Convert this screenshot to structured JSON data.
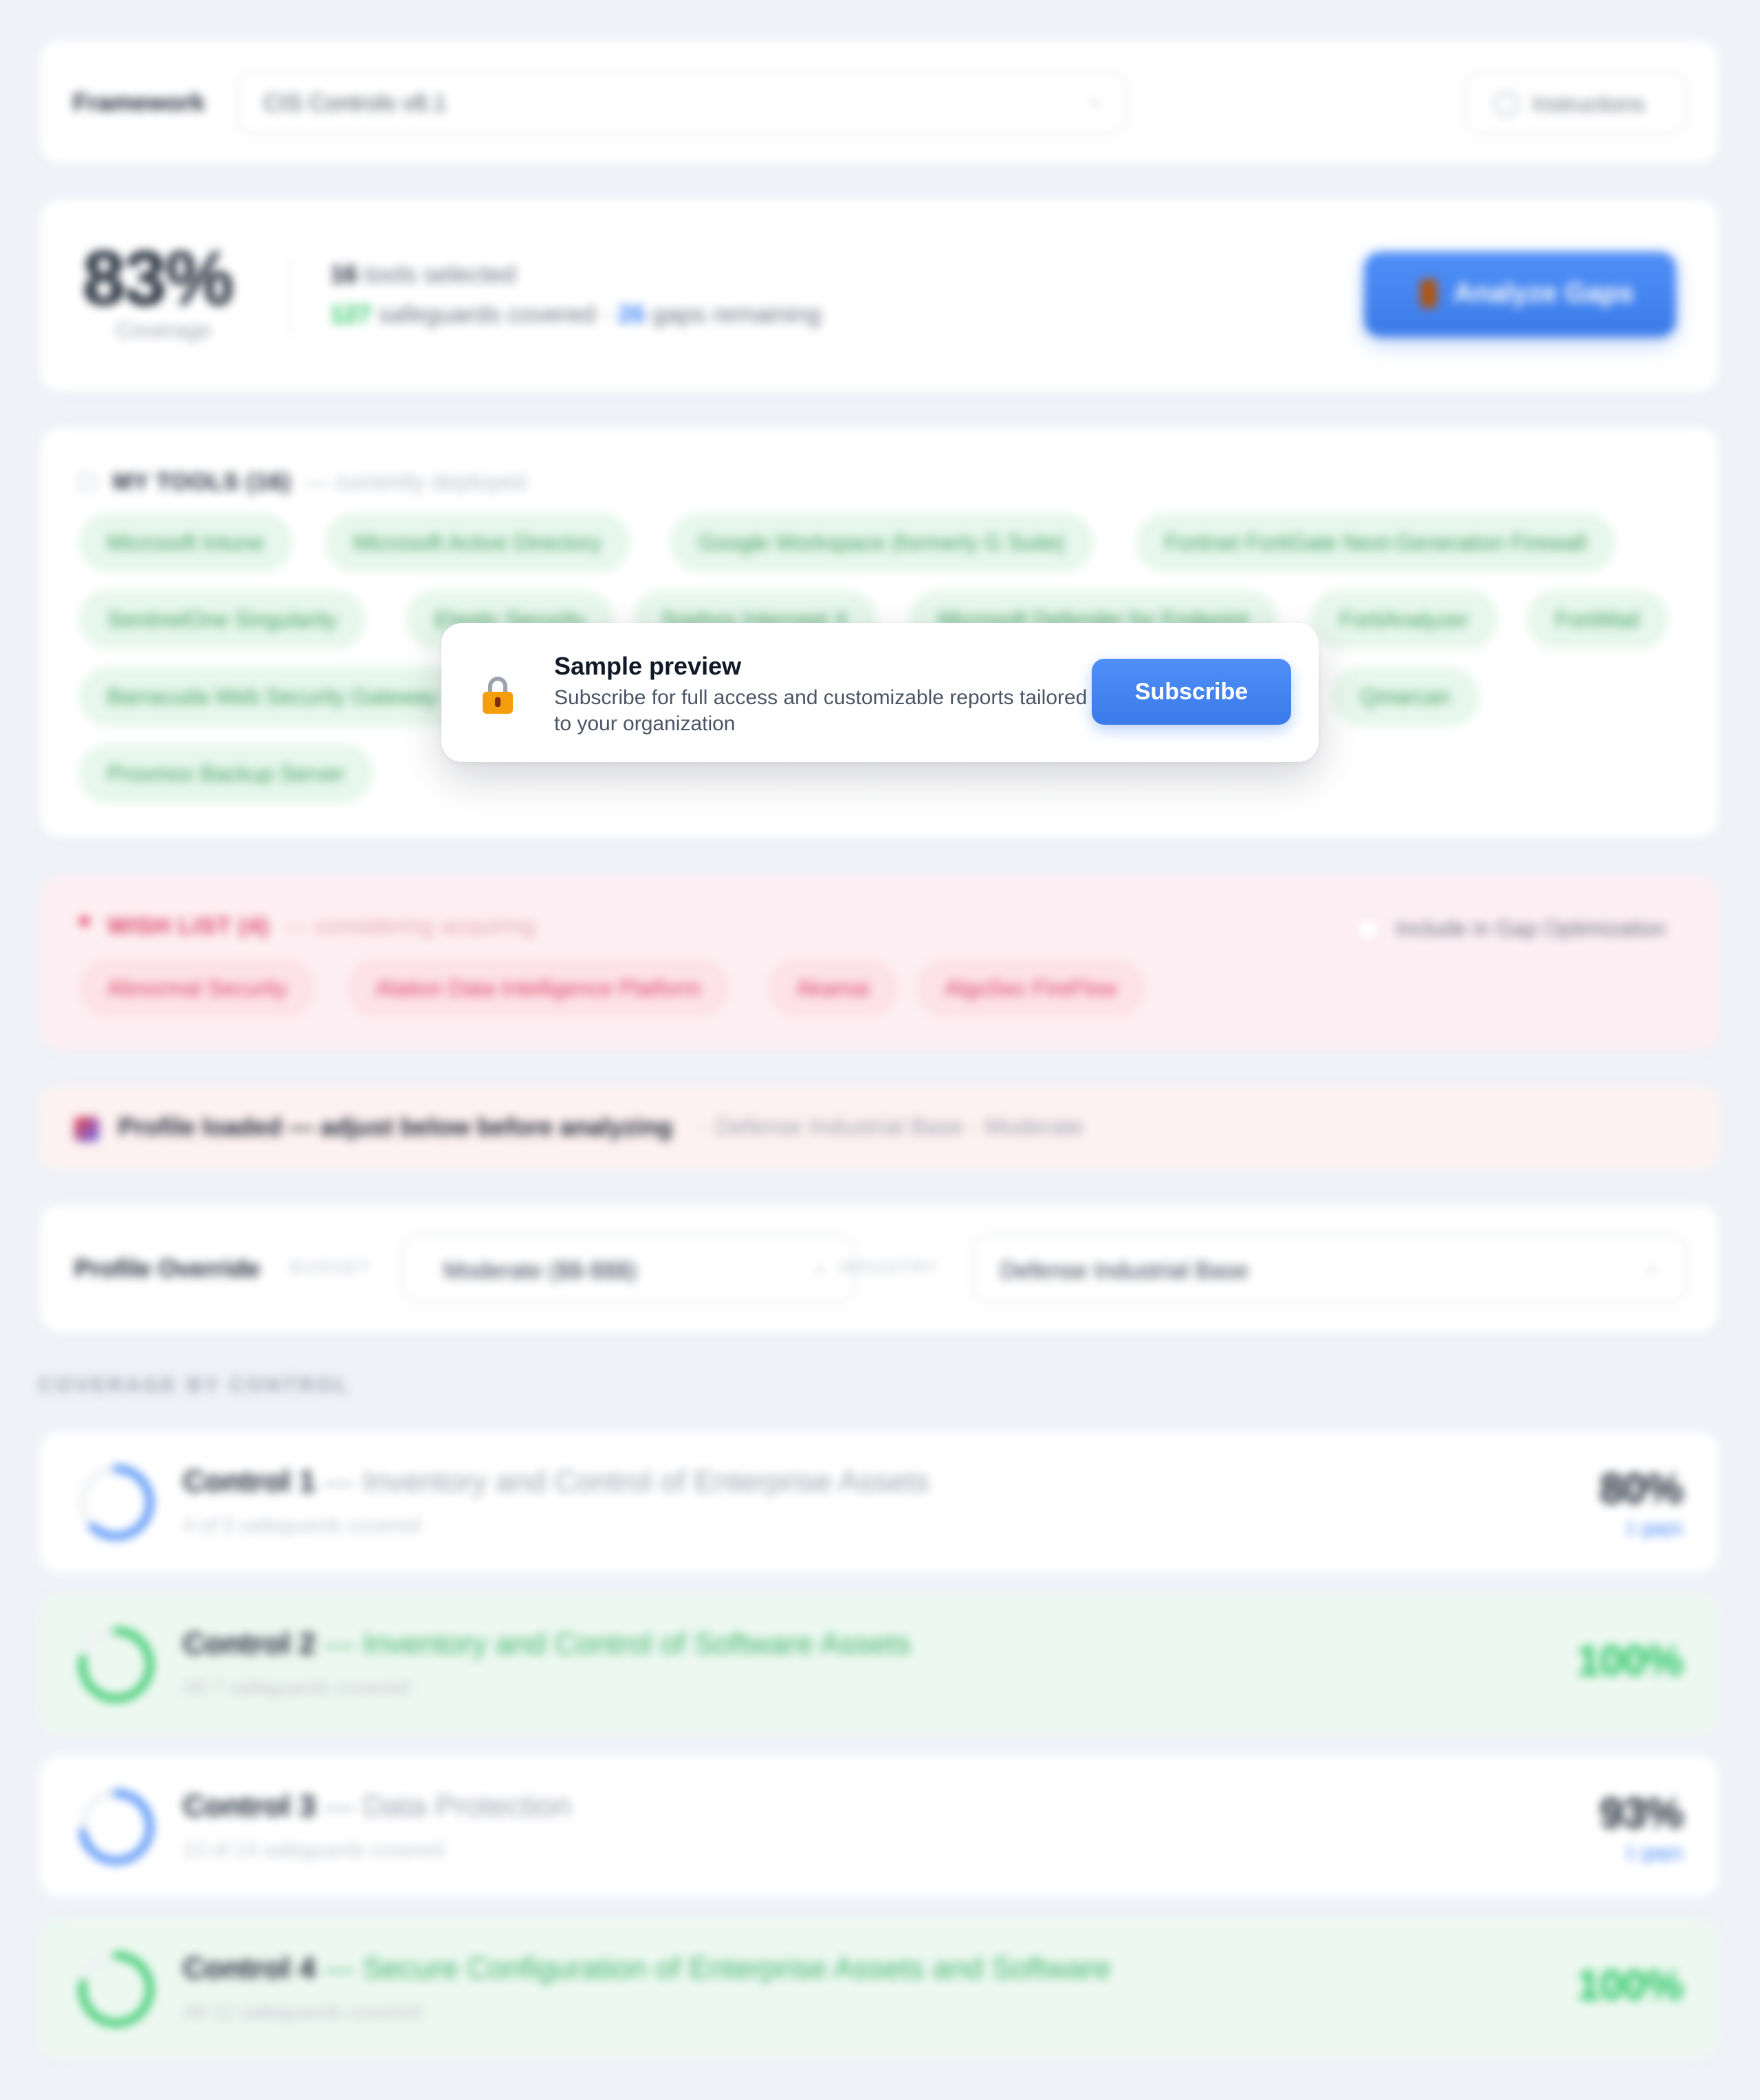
{
  "framework": {
    "label": "Framework",
    "value": "CIS Controls v8.1",
    "instructions_label": "Instructions"
  },
  "summary": {
    "coverage_pct": "83%",
    "coverage_label": "Coverage",
    "tools_selected_count": "16",
    "tools_selected_text": "tools selected",
    "safeguards_covered_count": "127",
    "safeguards_covered_text": "safeguards covered",
    "separator": "·",
    "gaps_count": "26",
    "gaps_text": "gaps remaining",
    "analyze_label": "Analyze Gaps"
  },
  "my_tools": {
    "title": "MY TOOLS (16)",
    "subtitle": "— currently deployed",
    "chips": [
      "Microsoft Intune",
      "Microsoft Active Directory",
      "Google Workspace (formerly G Suite)",
      "Fortinet FortiGate Next-Generation Firewall",
      "SentinelOne Singularity",
      "Elastic Security",
      "Sophos Intercept X",
      "Microsoft Defender for Endpoint",
      "FortiAnalyzer",
      "FortiMail",
      "Barracuda Web Security Gateway",
      "Qmarcan",
      "Proxmox Backup Server"
    ]
  },
  "wish_list": {
    "title": "WISH LIST (4)",
    "subtitle": "— considering acquiring",
    "include_label": "Include in Gap Optimization",
    "chips": [
      "Abnormal Security",
      "Alation Data Intelligence Platform",
      "Akamai",
      "AlgoSec FireFlow"
    ]
  },
  "profile_banner": {
    "text": "Profile loaded — adjust below before analyzing",
    "detail": "· Defense Industrial Base · Moderate"
  },
  "profile_override": {
    "title": "Profile Override",
    "budget_label": "BUDGET",
    "budget_value": "Moderate ($$-$$$)",
    "industry_label": "INDUSTRY",
    "industry_value": "Defense Industrial Base"
  },
  "coverage_by_control": {
    "title": "COVERAGE BY CONTROL",
    "controls": [
      {
        "name": "Control 1",
        "desc": "— Inventory and Control of Enterprise Assets",
        "safeguards": "4 of 5 safeguards covered",
        "pct": "80%",
        "pct_value": 0.8,
        "gaps": "1 gaps",
        "full": false,
        "color": "#3b82f6"
      },
      {
        "name": "Control 2",
        "desc": "— Inventory and Control of Software Assets",
        "safeguards": "All 7 safeguards covered",
        "pct": "100%",
        "pct_value": 1.0,
        "gaps": "",
        "full": true,
        "color": "#22c55e"
      },
      {
        "name": "Control 3",
        "desc": "— Data Protection",
        "safeguards": "13 of 14 safeguards covered",
        "pct": "93%",
        "pct_value": 0.93,
        "gaps": "1 gaps",
        "full": false,
        "color": "#3b82f6"
      },
      {
        "name": "Control 4",
        "desc": "— Secure Configuration of Enterprise Assets and Software",
        "safeguards": "All 12 safeguards covered",
        "pct": "100%",
        "pct_value": 1.0,
        "gaps": "",
        "full": true,
        "color": "#22c55e"
      }
    ]
  },
  "preview_dialog": {
    "title": "Sample preview",
    "text": "Subscribe for full access and customizable reports tailored to your organization",
    "button_label": "Subscribe",
    "lock_icon": "lock-icon"
  },
  "colors": {
    "accent": "#3b82f6",
    "success": "#22c55e",
    "wish": "#db3f63",
    "background": "#eff2f7"
  }
}
